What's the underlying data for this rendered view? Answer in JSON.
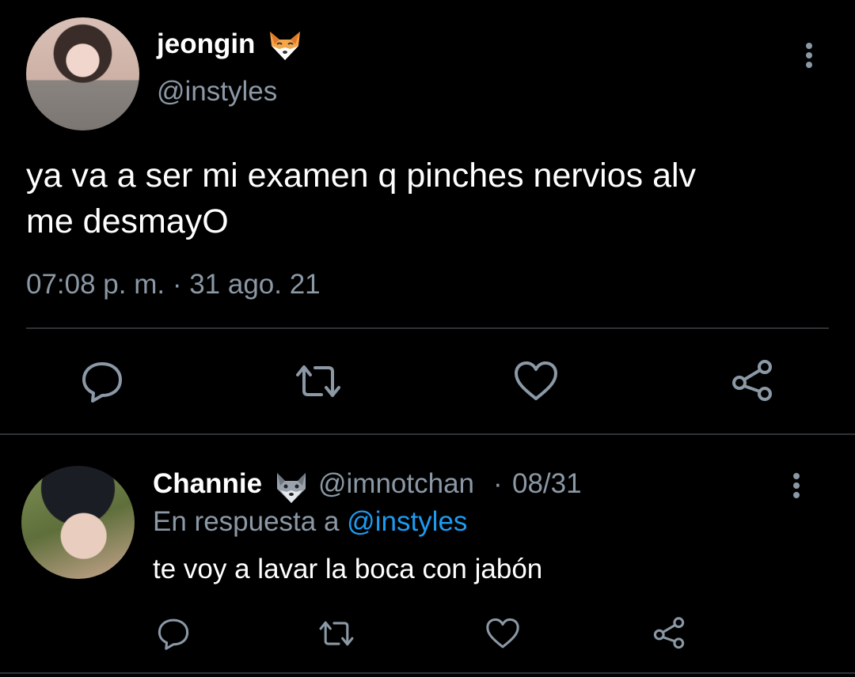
{
  "main_tweet": {
    "display_name": "jeongin",
    "name_emoji": "fox-emoji",
    "handle": "@instyles",
    "text_line1": "ya va a ser mi examen q pinches nervios alv",
    "text_line2": "me desmayO",
    "timestamp": "07:08 p. m. · 31 ago. 21",
    "actions": [
      "reply-icon",
      "retweet-icon",
      "like-icon",
      "share-icon"
    ]
  },
  "reply_tweet": {
    "display_name": "Channie",
    "name_emoji": "wolf-emoji",
    "handle": "@imnotchan",
    "separator": "·",
    "date": "08/31",
    "reply_prefix": "En respuesta a",
    "reply_to": "@instyles",
    "text": "te voy a lavar la boca con jabón",
    "actions": [
      "reply-icon",
      "retweet-icon",
      "like-icon",
      "share-icon"
    ]
  },
  "colors": {
    "background": "#000000",
    "text_primary": "#ffffff",
    "text_secondary": "#8b98a5",
    "link": "#1d9bf0",
    "divider": "#2f3336"
  }
}
